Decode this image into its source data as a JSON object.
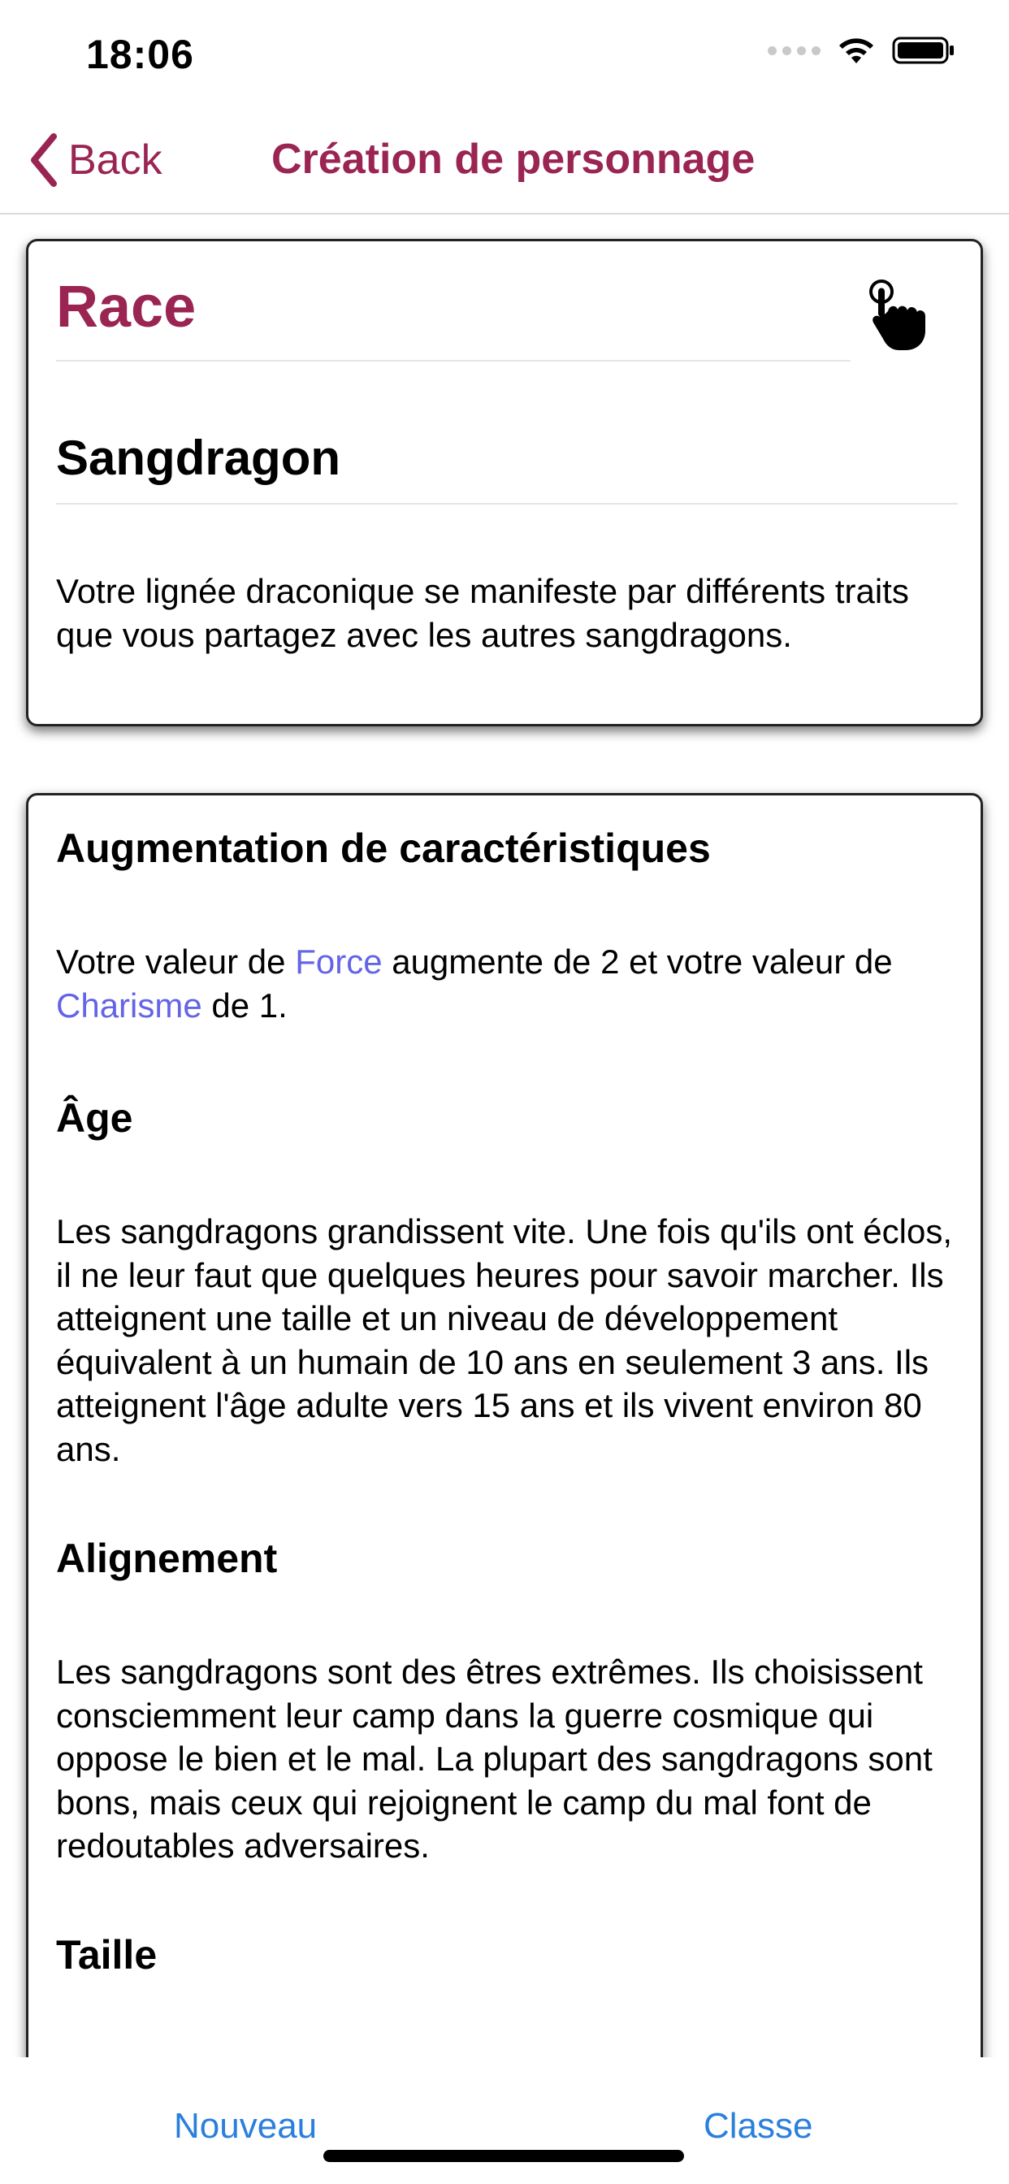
{
  "status_bar": {
    "time": "18:06"
  },
  "nav": {
    "back_label": "Back",
    "title": "Création de personnage"
  },
  "race_card": {
    "heading": "Race",
    "name": "Sangdragon",
    "description": "Votre lignée draconique se manifeste par différents traits que vous partagez avec les autres sangdragons."
  },
  "traits": {
    "ability": {
      "title": "Augmentation de caractéristiques",
      "text_1": "Votre valeur de ",
      "link_force": "Force",
      "text_2": " augmente de 2 et votre valeur de ",
      "link_charisme": "Charisme",
      "text_3": " de 1."
    },
    "age": {
      "title": "Âge",
      "text": "Les sangdragons grandissent vite. Une fois qu'ils ont éclos, il ne leur faut que quelques heures pour savoir marcher. Ils atteignent une taille et un niveau de développement équivalent à un humain de 10 ans en seulement 3 ans. Ils atteignent l'âge adulte vers 15 ans et ils vivent environ 80 ans."
    },
    "alignment": {
      "title": "Alignement",
      "text": "Les sangdragons sont des êtres extrêmes. Ils choisissent consciemment leur camp dans la guerre cosmique qui oppose le bien et le mal. La plupart des sangdragons sont bons, mais ceux qui rejoignent le camp du mal font de redoutables adversaires."
    },
    "size": {
      "title": "Taille"
    }
  },
  "toolbar": {
    "new_label": "Nouveau",
    "class_label": "Classe"
  },
  "colors": {
    "accent": "#9a2452",
    "link": "#6464e6",
    "toolbar_button": "#2b7fdc"
  },
  "icons": [
    "signal-icon",
    "wifi-icon",
    "battery-icon",
    "chevron-left-icon",
    "tap-hand-icon"
  ]
}
